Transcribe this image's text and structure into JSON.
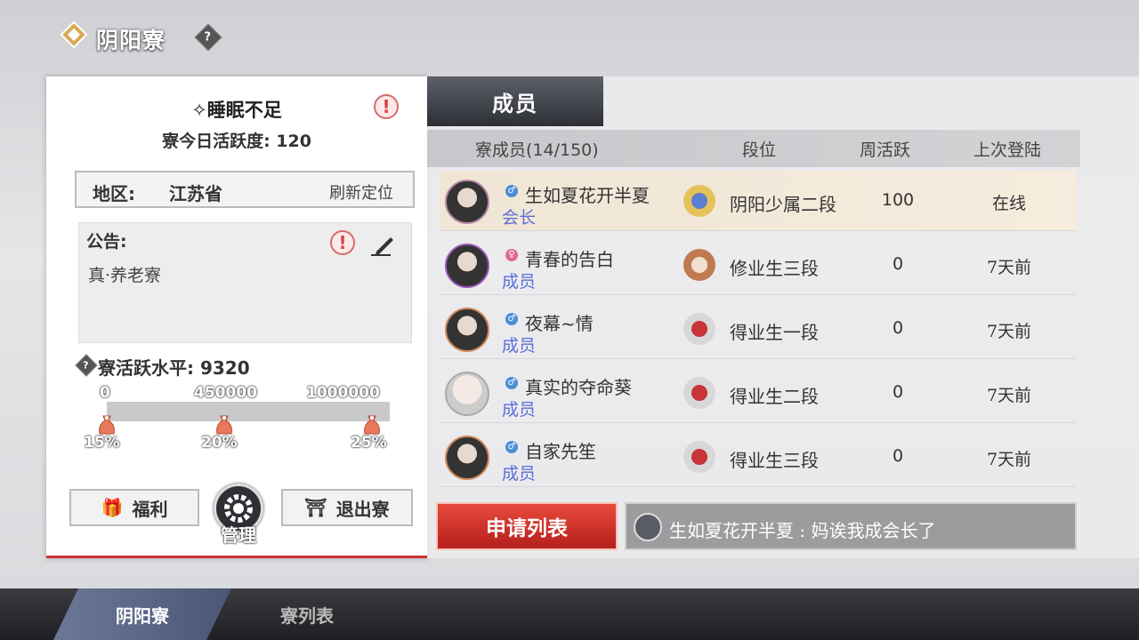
{
  "header": {
    "title": "阴阳寮",
    "help_icon": "question-diamond-icon"
  },
  "guild": {
    "name": "睡眠不足",
    "daily_activity": "寮今日活跃度: 120",
    "region_label": "地区:",
    "region_value": "江苏省",
    "refresh_location": "刷新定位",
    "notice_label": "公告:",
    "notice_text": "真·养老寮",
    "activity_level": "寮活跃水平: 9320",
    "progress": {
      "ticks": [
        "0",
        "450000",
        "1000000"
      ],
      "rewards": [
        "15%",
        "20%",
        "25%"
      ],
      "fill_fraction": 0
    },
    "buttons": {
      "welfare": "福利",
      "manage": "管理",
      "quit": "退出寮"
    }
  },
  "members_panel": {
    "tab_label": "成员",
    "columns": {
      "member": "寮成员(14/150)",
      "rank": "段位",
      "weekly": "周活跃",
      "last_login": "上次登陆"
    },
    "rows": [
      {
        "name": "生如夏花开半夏",
        "role": "会长",
        "gender": "male",
        "rank": "阴阳少属二段",
        "weekly": "100",
        "last": "在线",
        "highlight": true
      },
      {
        "name": "青春的告白",
        "role": "成员",
        "gender": "female",
        "rank": "修业生三段",
        "weekly": "0",
        "last": "7天前"
      },
      {
        "name": "夜幕~情",
        "role": "成员",
        "gender": "male",
        "rank": "得业生一段",
        "weekly": "0",
        "last": "7天前"
      },
      {
        "name": "真实的夺命葵",
        "role": "成员",
        "gender": "male",
        "rank": "得业生二段",
        "weekly": "0",
        "last": "7天前"
      },
      {
        "name": "自家先笙",
        "role": "成员",
        "gender": "male",
        "rank": "得业生三段",
        "weekly": "0",
        "last": "7天前"
      }
    ],
    "apply_list": "申请列表",
    "chat_message": "生如夏花开半夏 : 妈诶我成会长了"
  },
  "bottom_nav": {
    "tabs": [
      "阴阳寮",
      "寮列表"
    ]
  },
  "colors": {
    "accent_red": "#c9302c",
    "role_blue": "#5c6fd6",
    "highlight_row": "#f3e8d8"
  }
}
